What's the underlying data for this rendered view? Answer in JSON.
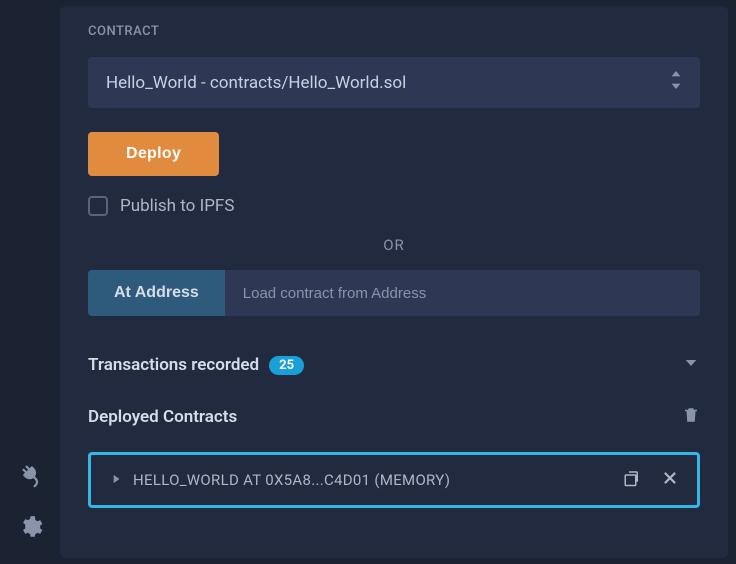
{
  "contract": {
    "label": "CONTRACT",
    "selected": "Hello_World - contracts/Hello_World.sol"
  },
  "deploy": {
    "button": "Deploy",
    "publish_label": "Publish to IPFS",
    "or_text": "OR",
    "at_address_label": "At Address",
    "address_placeholder": "Load contract from Address"
  },
  "transactions": {
    "title": "Transactions recorded",
    "count": "25"
  },
  "deployed": {
    "title": "Deployed Contracts",
    "instance": "HELLO_WORLD AT 0X5A8...C4D01 (MEMORY)"
  }
}
